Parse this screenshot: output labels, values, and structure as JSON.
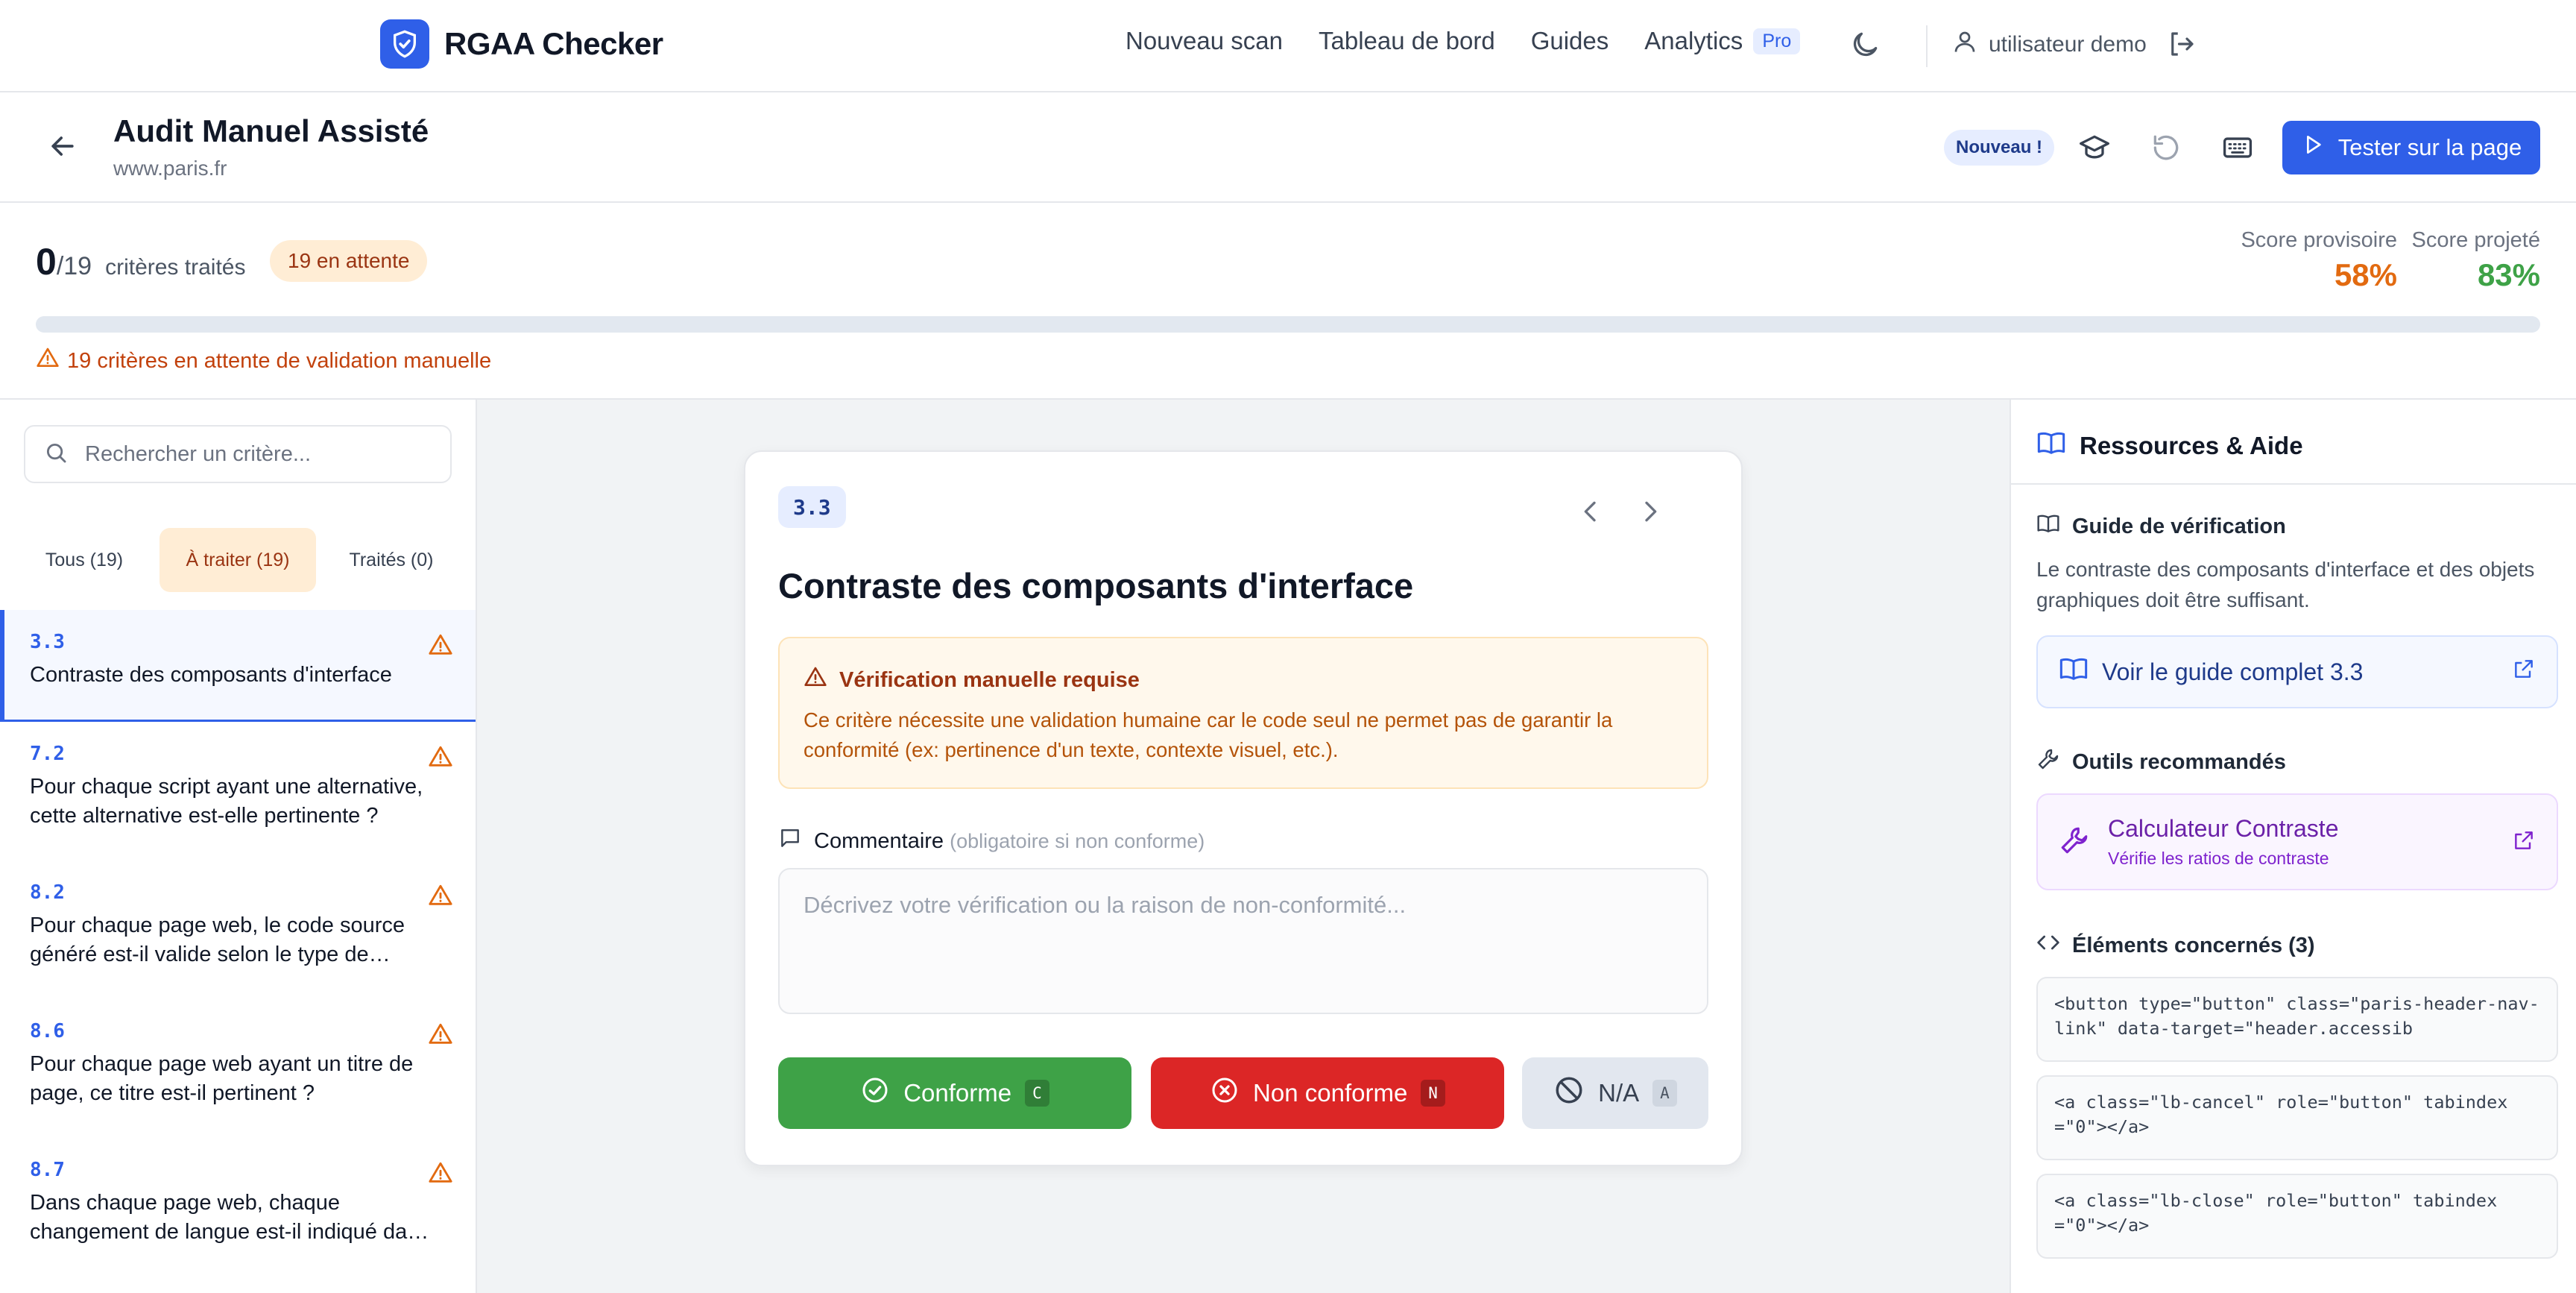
{
  "navbar": {
    "brand": "RGAA Checker",
    "links": [
      "Nouveau scan",
      "Tableau de bord",
      "Guides",
      "Analytics"
    ],
    "pro_badge": "Pro",
    "user": "utilisateur demo"
  },
  "subheader": {
    "title": "Audit Manuel Assisté",
    "url": "www.paris.fr",
    "new_badge": "Nouveau !",
    "test_button": "Tester sur la page"
  },
  "progress": {
    "done": "0",
    "total": "/19",
    "label": "critères traités",
    "pending_pill": "19 en attente",
    "fraction_done": 0,
    "warning": "19 critères en attente de validation manuelle",
    "score_provisional_label": "Score provisoire",
    "score_provisional": "58%",
    "score_projected_label": "Score projeté",
    "score_projected": "83%",
    "colors": {
      "provisional": "#e26a10",
      "projected": "#3ea247",
      "accent": "#2f5fe8"
    }
  },
  "sidebar": {
    "search_placeholder": "Rechercher un critère...",
    "tabs": [
      {
        "label": "Tous (19)"
      },
      {
        "label": "À traiter (19)"
      },
      {
        "label": "Traités (0)"
      }
    ],
    "items": [
      {
        "num": "3.3",
        "title": "Contraste des composants d'interface"
      },
      {
        "num": "7.2",
        "title": "Pour chaque script ayant une alternative, cette alternative est-elle pertinente ?"
      },
      {
        "num": "8.2",
        "title": "Pour chaque page web, le code source généré est-il valide selon le type de document ?"
      },
      {
        "num": "8.6",
        "title": "Pour chaque page web ayant un titre de page, ce titre est-il pertinent ?"
      },
      {
        "num": "8.7",
        "title": "Dans chaque page web, chaque changement de langue est-il indiqué dans le code source ?"
      }
    ]
  },
  "card": {
    "id": "3.3",
    "title": "Contraste des composants d'interface",
    "alert_title": "Vérification manuelle requise",
    "alert_text": "Ce critère nécessite une validation humaine car le code seul ne permet pas de garantir la conformité (ex: pertinence d'un texte, contexte visuel, etc.).",
    "comment_label": "Commentaire",
    "comment_hint": "(obligatoire si non conforme)",
    "comment_placeholder": "Décrivez votre vérification ou la raison de non-conformité...",
    "btn_ok": "Conforme",
    "btn_ok_key": "C",
    "btn_ko": "Non conforme",
    "btn_ko_key": "N",
    "btn_na": "N/A",
    "btn_na_key": "A"
  },
  "rpanel": {
    "title": "Ressources & Aide",
    "guide_title": "Guide de vérification",
    "guide_text": "Le contraste des composants d'interface et des objets graphiques doit être suffisant.",
    "guide_link": "Voir le guide complet 3.3",
    "tools_title": "Outils recommandés",
    "tool_name": "Calculateur Contraste",
    "tool_desc": "Vérifie les ratios de contraste",
    "elements_title": "Éléments concernés (3)",
    "elements": [
      "<button type=\"button\" class=\"paris-header-nav-link\" data-target=\"header.accessib",
      "<a class=\"lb-cancel\" role=\"button\" tabindex=\"0\"></a>",
      "<a class=\"lb-close\" role=\"button\" tabindex=\"0\"></a>"
    ]
  }
}
